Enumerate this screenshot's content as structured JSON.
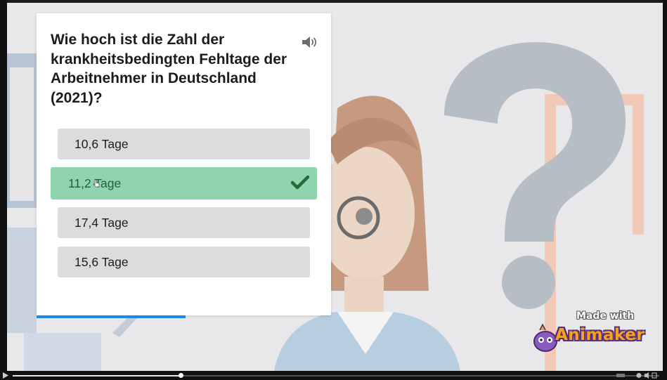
{
  "quiz": {
    "question": "Wie hoch ist die Zahl der krankheitsbedingten Fehltage der Arbeitnehmer in Deutschland (2021)?",
    "answers": [
      {
        "label": "10,6 Tage",
        "state": "default"
      },
      {
        "label": "11,2 Tage",
        "state": "correct-selected"
      },
      {
        "label": "17,4 Tage",
        "state": "default"
      },
      {
        "label": "15,6 Tage",
        "state": "default"
      }
    ],
    "speaker_icon": "speaker-icon",
    "check_icon": "checkmark-icon"
  },
  "watermark": {
    "made_with": "Made with",
    "brand": "Animaker"
  },
  "player": {
    "progress_fraction": 0.26
  },
  "colors": {
    "correct_bg": "#8fd4ac",
    "check": "#1f6b3d",
    "answer_bg": "#dcdcdc",
    "accent_blue": "#1e88e5"
  }
}
